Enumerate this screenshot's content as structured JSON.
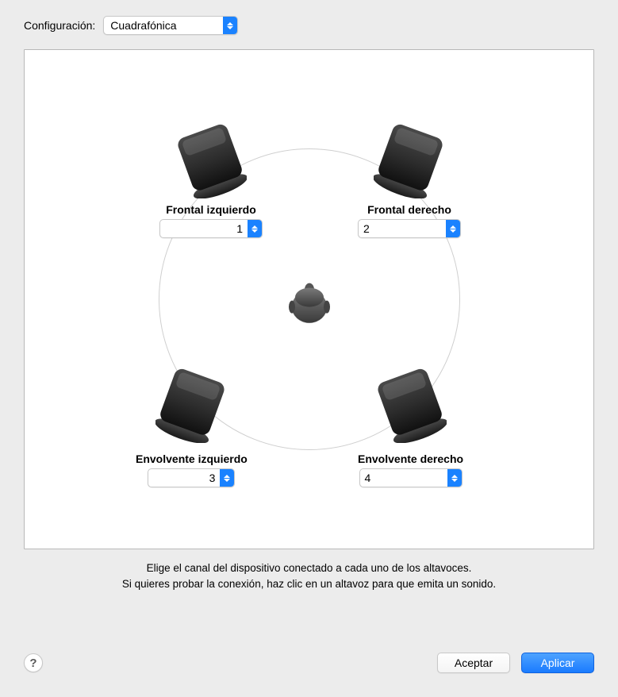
{
  "config_label": "Configuración:",
  "config_value": "Cuadrafónica",
  "speakers": {
    "fl": {
      "label": "Frontal izquierdo",
      "value": "1"
    },
    "fr": {
      "label": "Frontal derecho",
      "value": "2"
    },
    "rl": {
      "label": "Envolvente izquierdo",
      "value": "3"
    },
    "rr": {
      "label": "Envolvente derecho",
      "value": "4"
    }
  },
  "hint_line1": "Elige el canal del dispositivo conectado a cada uno de los altavoces.",
  "hint_line2": "Si quieres probar la conexión, haz clic en un altavoz para que emita un sonido.",
  "help_glyph": "?",
  "buttons": {
    "ok": "Aceptar",
    "apply": "Aplicar"
  }
}
